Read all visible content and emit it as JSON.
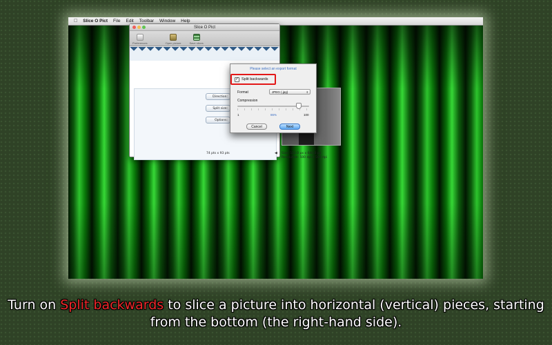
{
  "menubar": {
    "app_name": "Slice O Pict",
    "items": [
      "File",
      "Edit",
      "Toolbar",
      "Window",
      "Help"
    ]
  },
  "window": {
    "title": "Slice O Pict",
    "toolbar": [
      {
        "label": "Preferences",
        "icon": "preferences-icon"
      },
      {
        "label": "Open picture",
        "icon": "open-picture-icon"
      },
      {
        "label": "Save slices",
        "icon": "save-slices-icon"
      }
    ],
    "side_buttons": [
      "Direction:",
      "Split size:",
      "Options:"
    ],
    "slice_size": "74 pts x 93 pts",
    "image_info": {
      "size": "Size: 512.0 px x 640.0 px",
      "resolution": "Resolution: 500 dpi x 500 dpi"
    }
  },
  "sheet": {
    "title": "Please select an export format",
    "split_backwards_label": "Split backwards",
    "split_backwards_checked": true,
    "format_label": "Format",
    "format_value": "JPEG (.jpg)",
    "compression_label": "Compression",
    "compression_min": "1",
    "compression_value": "86%",
    "compression_fraction": 0.86,
    "compression_max": "100",
    "cancel_label": "Cancel",
    "next_label": "Next"
  },
  "caption": {
    "before": "Turn on ",
    "highlight": "Split backwards",
    "after": " to slice a picture into horizontal (vertical) pieces, starting from the bottom (the right-hand side).",
    "highlight_color": "#f0282a"
  }
}
